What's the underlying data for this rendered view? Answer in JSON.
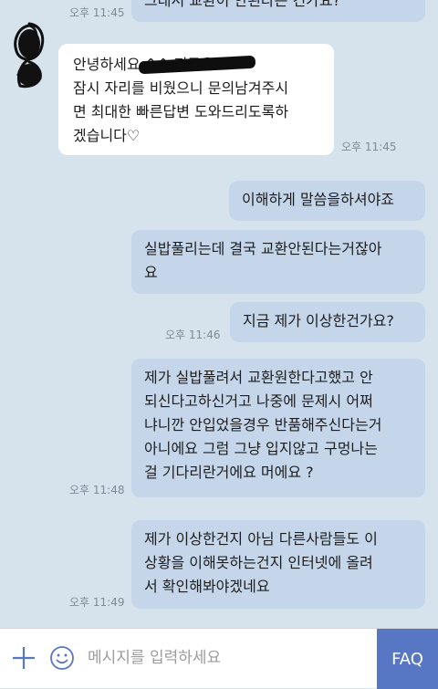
{
  "messages": [
    {
      "from": "me",
      "text": "그래서 교환이 안된다는 건가요?",
      "time": "오후 11:45"
    },
    {
      "from": "agent",
      "text": "안녕하세요 ^^ 지금은\n잠시 자리를 비웠으니 문의남겨주시\n면 최대한 빠른답변 도와드리도록하\n겠습니다♡",
      "time": "오후 11:45"
    },
    {
      "from": "me",
      "text": "이해하게 말씀을하셔야죠"
    },
    {
      "from": "me",
      "text": "실밥풀리는데 결국 교환안된다는거잖아\n요"
    },
    {
      "from": "me",
      "text": "지금 제가 이상한건가요?",
      "time": "오후 11:46"
    },
    {
      "from": "me",
      "text": "제가 실밥풀려서 교환원한다고했고 안\n되신다고하신거고 나중에 문제시 어쩌\n냐니깐 안입었을경우 반품해주신다는거\n아니에요 그럼 그냥 입지않고 구멍나는\n걸 기다리란거에요 머에요 ?",
      "time": "오후 11:48"
    },
    {
      "from": "me",
      "text": "제가 이상한건지 아님 다른사람들도 이\n상황을 이해못하는건지 인터넷에 올려\n서 확인해봐야겠네요",
      "time": "오후 11:49"
    }
  ],
  "input": {
    "placeholder": "메시지를 입력하세요",
    "value": ""
  },
  "toolbar": {
    "add_icon": "plus-icon",
    "emoji_icon": "smiley-icon",
    "faq_label": "FAQ"
  },
  "colors": {
    "background": "#d6e2ec",
    "outgoing_bubble": "#c5d6ea",
    "incoming_bubble": "#ffffff",
    "accent": "#5777c4",
    "timestamp": "#7e8a96"
  }
}
